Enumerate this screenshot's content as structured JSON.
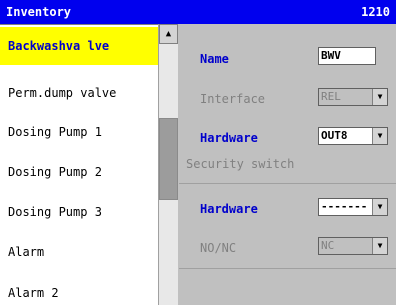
{
  "window": {
    "title": "Inventory",
    "code": "1210"
  },
  "list": {
    "items": [
      {
        "label": "Backwashva lve",
        "selected": true
      },
      {
        "label": "Perm.dump valve",
        "selected": false
      },
      {
        "label": "Dosing Pump 1",
        "selected": false
      },
      {
        "label": "Dosing Pump 2",
        "selected": false
      },
      {
        "label": "Dosing Pump 3",
        "selected": false
      },
      {
        "label": "Alarm",
        "selected": false
      },
      {
        "label": "Alarm 2",
        "selected": false
      }
    ]
  },
  "details": {
    "name_label": "Name",
    "name_value": "BWV",
    "interface_label": "Interface",
    "interface_value": "REL",
    "hardware_label": "Hardware",
    "hardware_value": "OUT8",
    "security_title": "Security switch",
    "security_hardware_label": "Hardware",
    "security_hardware_value": "-------",
    "nonc_label": "NO/NC",
    "nonc_value": "NC"
  },
  "icons": {
    "scroll_up": "scroll-up-arrow-icon",
    "dropdown": "dropdown-arrow-icon"
  },
  "colors": {
    "titlebar": "#0000ee",
    "selection": "#ffff00",
    "label_blue": "#0000cc",
    "panel": "#c0c0c0"
  }
}
